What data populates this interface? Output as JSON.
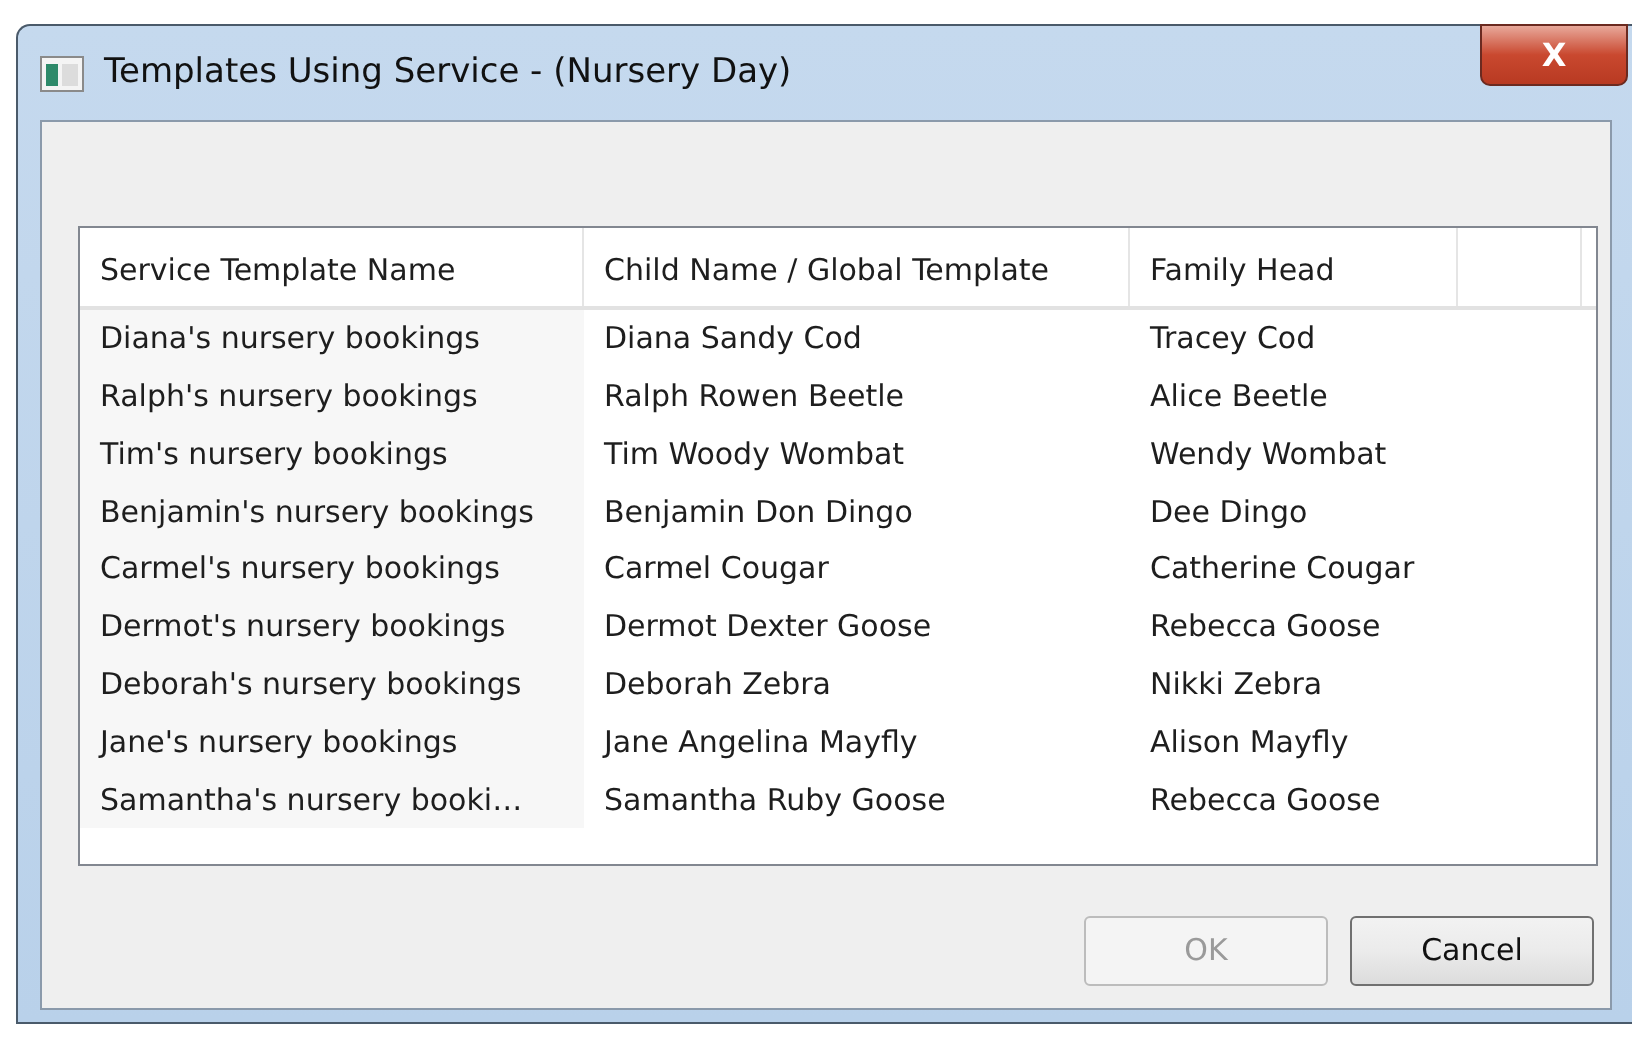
{
  "window": {
    "title": "Templates Using Service - (Nursery Day)",
    "close_label": "X"
  },
  "table": {
    "columns": [
      "Service Template Name",
      "Child Name / Global Template",
      "Family Head"
    ],
    "rows": [
      [
        "Diana's nursery bookings",
        "Diana Sandy Cod",
        "Tracey Cod"
      ],
      [
        "Ralph's nursery bookings",
        "Ralph Rowen Beetle",
        "Alice Beetle"
      ],
      [
        "Tim's nursery bookings",
        "Tim Woody Wombat",
        "Wendy Wombat"
      ],
      [
        "Benjamin's nursery bookings",
        "Benjamin Don Dingo",
        "Dee Dingo"
      ],
      [
        "Carmel's nursery bookings",
        "Carmel Cougar",
        "Catherine Cougar"
      ],
      [
        "Dermot's nursery bookings",
        "Dermot Dexter Goose",
        "Rebecca Goose"
      ],
      [
        "Deborah's nursery bookings",
        "Deborah Zebra",
        "Nikki Zebra"
      ],
      [
        "Jane's nursery bookings",
        "Jane Angelina Mayfly",
        "Alison Mayfly"
      ],
      [
        "Samantha's nursery booki…",
        "Samantha Ruby Goose",
        "Rebecca Goose"
      ]
    ]
  },
  "buttons": [
    {
      "label": "OK",
      "disabled": true
    },
    {
      "label": "Cancel",
      "disabled": false
    }
  ]
}
